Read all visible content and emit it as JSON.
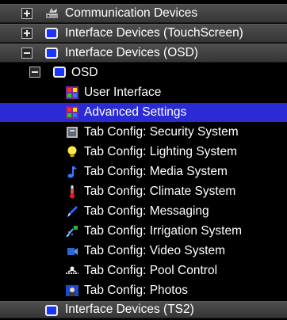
{
  "tree": {
    "items": [
      {
        "label": "Communication Devices",
        "icon": "communication-devices-icon",
        "expander": "plus"
      },
      {
        "label": "Interface Devices (TouchScreen)",
        "icon": "monitor-icon",
        "expander": "plus"
      },
      {
        "label": "Interface Devices (OSD)",
        "icon": "monitor-icon",
        "expander": "minus"
      },
      {
        "label": "OSD",
        "icon": "monitor-icon",
        "expander": "minus"
      },
      {
        "label": "User Interface",
        "icon": "color-grid-icon"
      },
      {
        "label": "Advanced Settings",
        "icon": "color-grid-icon",
        "selected": true
      },
      {
        "label": "Tab Config: Security System",
        "icon": "security-panel-icon"
      },
      {
        "label": "Tab Config: Lighting System",
        "icon": "lightbulb-icon"
      },
      {
        "label": "Tab Config: Media System",
        "icon": "music-note-icon"
      },
      {
        "label": "Tab Config: Climate System",
        "icon": "thermometer-icon"
      },
      {
        "label": "Tab Config: Messaging",
        "icon": "pen-icon"
      },
      {
        "label": "Tab Config: Irrigation System",
        "icon": "irrigation-icon"
      },
      {
        "label": "Tab Config: Video System",
        "icon": "video-camera-icon"
      },
      {
        "label": "Tab Config: Pool Control",
        "icon": "pool-icon"
      },
      {
        "label": "Tab Config: Photos",
        "icon": "photo-icon"
      },
      {
        "label": "Interface Devices (TS2)",
        "icon": "monitor-icon"
      }
    ]
  },
  "colors": {
    "selection": "#2b2bd6",
    "band": "#444444",
    "background": "#000000"
  }
}
